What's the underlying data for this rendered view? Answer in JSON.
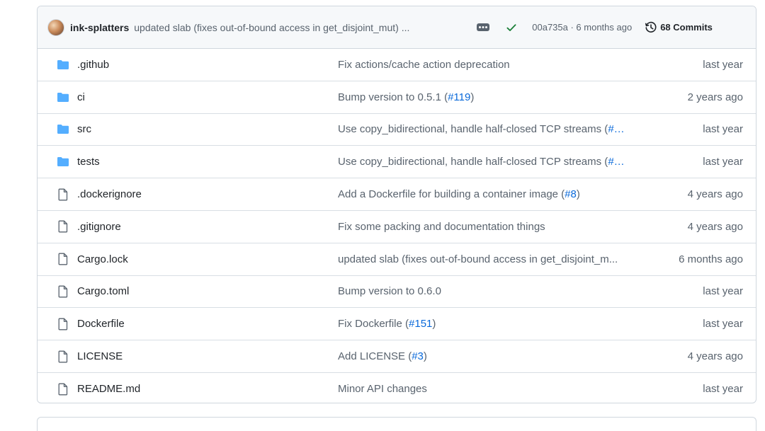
{
  "commit": {
    "author": "ink-splatters",
    "message": "updated slab (fixes out-of-bound access in get_disjoint_mut) ...",
    "meta": "00a735a · 6 months ago",
    "commits_label": "68 Commits"
  },
  "files": [
    {
      "type": "folder",
      "name": ".github",
      "msg": "Fix actions/cache action deprecation",
      "link": "",
      "suffix": "",
      "age": "last year"
    },
    {
      "type": "folder",
      "name": "ci",
      "msg": "Bump version to 0.5.1 (",
      "link": "#119",
      "suffix": ")",
      "age": "2 years ago"
    },
    {
      "type": "folder",
      "name": "src",
      "msg": "Use copy_bidirectional, handle half-closed TCP streams (",
      "link": "#…",
      "suffix": "",
      "age": "last year"
    },
    {
      "type": "folder",
      "name": "tests",
      "msg": "Use copy_bidirectional, handle half-closed TCP streams (",
      "link": "#…",
      "suffix": "",
      "age": "last year"
    },
    {
      "type": "file",
      "name": ".dockerignore",
      "msg": "Add a Dockerfile for building a container image (",
      "link": "#8",
      "suffix": ")",
      "age": "4 years ago"
    },
    {
      "type": "file",
      "name": ".gitignore",
      "msg": "Fix some packing and documentation things",
      "link": "",
      "suffix": "",
      "age": "4 years ago"
    },
    {
      "type": "file",
      "name": "Cargo.lock",
      "msg": "updated slab (fixes out-of-bound access in get_disjoint_m...",
      "link": "",
      "suffix": "",
      "age": "6 months ago"
    },
    {
      "type": "file",
      "name": "Cargo.toml",
      "msg": "Bump version to 0.6.0",
      "link": "",
      "suffix": "",
      "age": "last year"
    },
    {
      "type": "file",
      "name": "Dockerfile",
      "msg": "Fix Dockerfile (",
      "link": "#151",
      "suffix": ")",
      "age": "last year"
    },
    {
      "type": "file",
      "name": "LICENSE",
      "msg": "Add LICENSE (",
      "link": "#3",
      "suffix": ")",
      "age": "4 years ago"
    },
    {
      "type": "file",
      "name": "README.md",
      "msg": "Minor API changes",
      "link": "",
      "suffix": "",
      "age": "last year"
    }
  ],
  "colors": {
    "folder": "#54aeff",
    "link": "#0969da",
    "check": "#1a7f37"
  }
}
